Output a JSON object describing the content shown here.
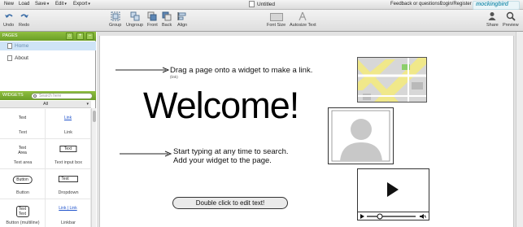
{
  "menubar": {
    "items": [
      {
        "label": "New",
        "has_caret": false
      },
      {
        "label": "Load",
        "has_caret": false
      },
      {
        "label": "Save",
        "has_caret": true
      },
      {
        "label": "Edit",
        "has_caret": true
      },
      {
        "label": "Export",
        "has_caret": true
      }
    ],
    "document_title": "Untitled",
    "feedback_link": "Feedback or questions?",
    "login_link": "Login/Register",
    "brand": "mockingbird"
  },
  "toolbar": {
    "undo": "Undo",
    "redo": "Redo",
    "group": "Group",
    "ungroup": "Ungroup",
    "front": "Front",
    "back": "Back",
    "align": "Align",
    "font_size": "Font Size",
    "autosize_text": "Autosize Text",
    "share": "Share",
    "preview": "Preview"
  },
  "pages_panel": {
    "header": "PAGES",
    "pages": [
      {
        "label": "Home",
        "selected": true
      },
      {
        "label": "About",
        "selected": false
      }
    ]
  },
  "widgets_panel": {
    "header": "WIDGETS",
    "search_placeholder": "Search here",
    "filter": "All",
    "widgets": [
      {
        "label": "Text",
        "preview": "Text"
      },
      {
        "label": "Link",
        "preview": "Link"
      },
      {
        "label": "Text area",
        "preview": "Text Area"
      },
      {
        "label": "Text input box",
        "preview": "Text"
      },
      {
        "label": "Button",
        "preview": "Button"
      },
      {
        "label": "Dropdown",
        "preview": "Text"
      },
      {
        "label": "Button (multiline)",
        "preview": "Text Text"
      },
      {
        "label": "Linkbar",
        "preview": "Link | Link"
      }
    ]
  },
  "canvas": {
    "drag_hint": "Drag a page onto a widget to make a link.",
    "drag_hint_small": "(link)",
    "welcome": "Welcome!",
    "search_hint_line1": "Start typing at any time to search.",
    "search_hint_line2": "Add your widget to the page.",
    "edit_button": "Double click to edit text!"
  },
  "colors": {
    "accent_green": "#7bad32",
    "selection_blue": "#cfe4f7",
    "brand_blue": "#3a9bb6"
  }
}
